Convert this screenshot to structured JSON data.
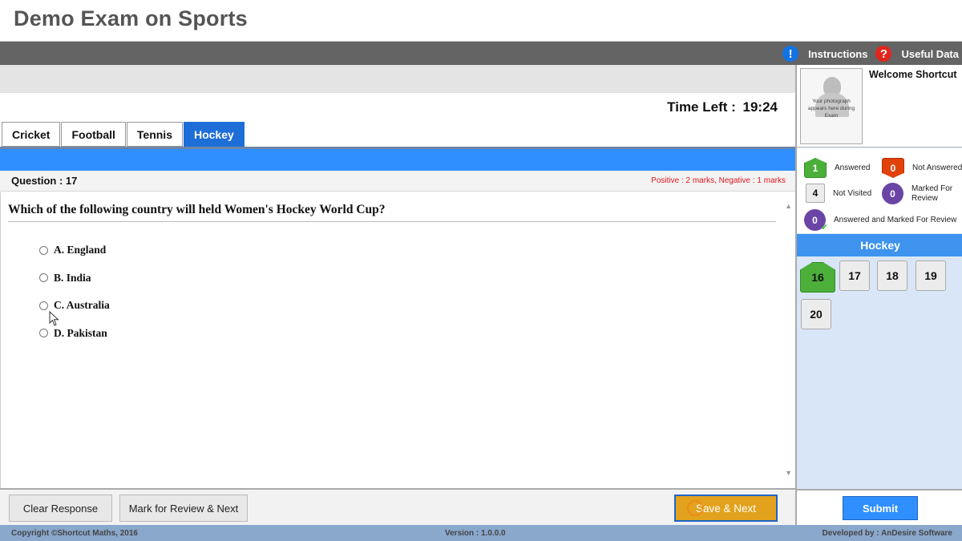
{
  "header": {
    "title": "Demo Exam on Sports"
  },
  "toplinks": {
    "instructions": "Instructions",
    "useful_data": "Useful Data",
    "info_glyph": "!",
    "help_glyph": "?"
  },
  "timer": {
    "label": "Time Left :",
    "value": "19:24"
  },
  "tabs": [
    {
      "label": "Cricket",
      "active": false
    },
    {
      "label": "Football",
      "active": false
    },
    {
      "label": "Tennis",
      "active": false
    },
    {
      "label": "Hockey",
      "active": true
    }
  ],
  "question": {
    "number_label": "Question : 17",
    "marks": "Positive : 2 marks, Negative : 1 marks",
    "text": "Which of the following country will held Women's Hockey World Cup?",
    "options": [
      "A. England",
      "B. India",
      "C. Australia",
      "D. Pakistan"
    ]
  },
  "buttons": {
    "clear": "Clear Response",
    "mark_review": "Mark for Review & Next",
    "save_next": "Save & Next",
    "submit": "Submit"
  },
  "profile": {
    "welcome": "Welcome Shortcut",
    "photo_caption": "Your photograph appears here during Exam"
  },
  "legend": {
    "answered": {
      "count": "1",
      "label": "Answered"
    },
    "not_answered": {
      "count": "0",
      "label": "Not Answered"
    },
    "not_visited": {
      "count": "4",
      "label": "Not Visited"
    },
    "marked_review": {
      "count": "0",
      "label": "Marked For Review"
    },
    "answered_marked": {
      "count": "0",
      "label": "Answered and Marked For Review"
    }
  },
  "palette": {
    "section": "Hockey",
    "questions": [
      {
        "num": "16",
        "status": "answered"
      },
      {
        "num": "17",
        "status": "not-visited"
      },
      {
        "num": "18",
        "status": "not-visited"
      },
      {
        "num": "19",
        "status": "not-visited"
      },
      {
        "num": "20",
        "status": "not-visited"
      }
    ]
  },
  "footer": {
    "copyright": "Copyright ©Shortcut Maths, 2016",
    "version": "Version : 1.0.0.0",
    "developer": "Developed by : AnDesire Software"
  },
  "colors": {
    "accent_blue": "#2f8fff",
    "answered_green": "#4caf3a",
    "not_answered_red": "#e1420a",
    "review_purple": "#6a45a5",
    "save_orange": "#e2a21d"
  }
}
